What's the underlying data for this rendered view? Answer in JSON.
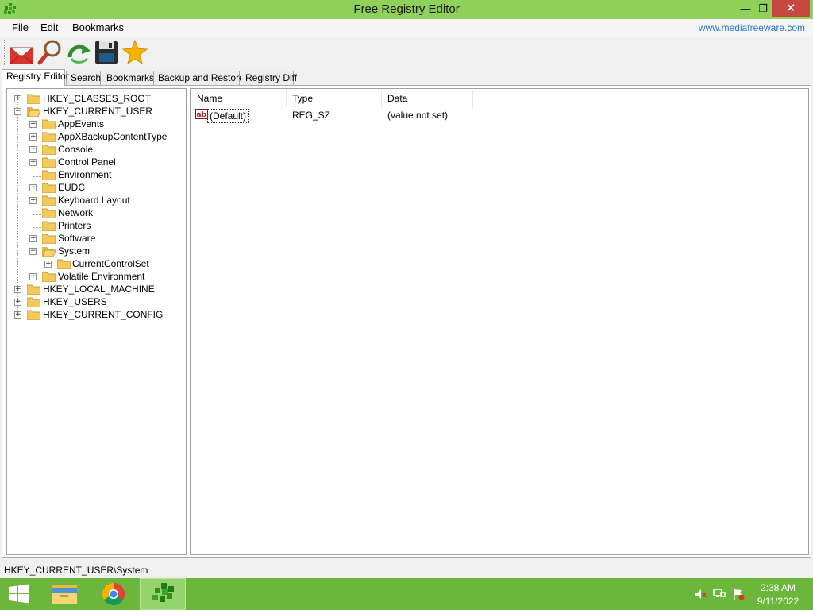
{
  "window": {
    "title": "Free Registry Editor"
  },
  "menu": {
    "file": "File",
    "edit": "Edit",
    "bookmarks": "Bookmarks",
    "website": "www.mediafreeware.com"
  },
  "toolbar": [
    "mail-icon",
    "search-icon",
    "refresh-icon",
    "save-icon",
    "star-icon"
  ],
  "tabs": [
    "Registry Editor",
    "Search",
    "Bookmarks",
    "Backup and Restore",
    "Registry Diff"
  ],
  "active_tab": "Registry Editor",
  "tree": {
    "roots": [
      "HKEY_CLASSES_ROOT",
      "HKEY_CURRENT_USER",
      "HKEY_LOCAL_MACHINE",
      "HKEY_USERS",
      "HKEY_CURRENT_CONFIG"
    ],
    "current_user_children": [
      "AppEvents",
      "AppXBackupContentType",
      "Console",
      "Control Panel",
      "Environment",
      "EUDC",
      "Keyboard Layout",
      "Network",
      "Printers",
      "Software",
      "System",
      "Volatile Environment"
    ],
    "system_children": [
      "CurrentControlSet"
    ],
    "selected": "System"
  },
  "list": {
    "columns": [
      "Name",
      "Type",
      "Data"
    ],
    "rows": [
      {
        "name": "(Default)",
        "type": "REG_SZ",
        "data": "(value not set)"
      }
    ]
  },
  "status": "HKEY_CURRENT_USER\\System",
  "clock": {
    "time": "2:38 AM",
    "date": "9/11/2022"
  },
  "colors": {
    "title_bar": "#8fd15a",
    "taskbar": "#6cb63b",
    "close_button": "#c7483f",
    "link": "#2a78c8"
  }
}
